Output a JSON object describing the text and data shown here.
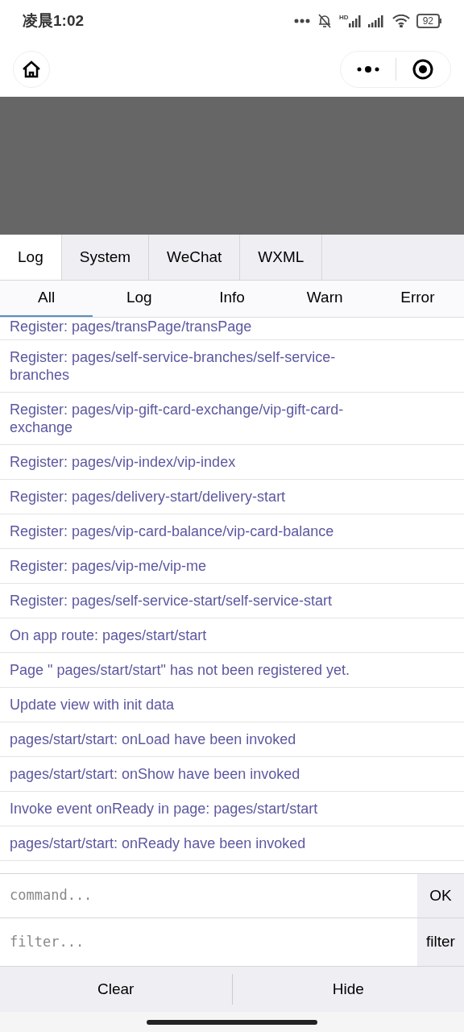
{
  "status_bar": {
    "time": "凌晨1:02",
    "network_label": "HD",
    "battery": "92"
  },
  "tabs": [
    {
      "label": "Log",
      "selected": true
    },
    {
      "label": "System",
      "selected": false
    },
    {
      "label": "WeChat",
      "selected": false
    },
    {
      "label": "WXML",
      "selected": false
    }
  ],
  "filters": [
    {
      "label": "All",
      "selected": true
    },
    {
      "label": "Log",
      "selected": false
    },
    {
      "label": "Info",
      "selected": false
    },
    {
      "label": "Warn",
      "selected": false
    },
    {
      "label": "Error",
      "selected": false
    }
  ],
  "log_entries": [
    {
      "text": "Register: pages/transPage/transPage"
    },
    {
      "text": "Register: pages/self-service-branches/self-service-branches"
    },
    {
      "text": "Register: pages/vip-gift-card-exchange/vip-gift-card-exchange"
    },
    {
      "text": "Register: pages/vip-index/vip-index"
    },
    {
      "text": "Register: pages/delivery-start/delivery-start"
    },
    {
      "text": "Register: pages/vip-card-balance/vip-card-balance"
    },
    {
      "text": "Register: pages/vip-me/vip-me"
    },
    {
      "text": "Register: pages/self-service-start/self-service-start"
    },
    {
      "text": "On app route: pages/start/start"
    },
    {
      "text": "Page \" pages/start/start\" has not been registered yet."
    },
    {
      "text": "Update view with init data"
    },
    {
      "text": "pages/start/start: onLoad have been invoked"
    },
    {
      "text": "pages/start/start: onShow have been invoked"
    },
    {
      "text": "Invoke event onReady in page: pages/start/start"
    },
    {
      "text": "pages/start/start: onReady have been invoked"
    }
  ],
  "command": {
    "placeholder": "command...",
    "button": "OK"
  },
  "filter": {
    "placeholder": "filter...",
    "button": "filter"
  },
  "actions": [
    "Clear",
    "Hide"
  ]
}
